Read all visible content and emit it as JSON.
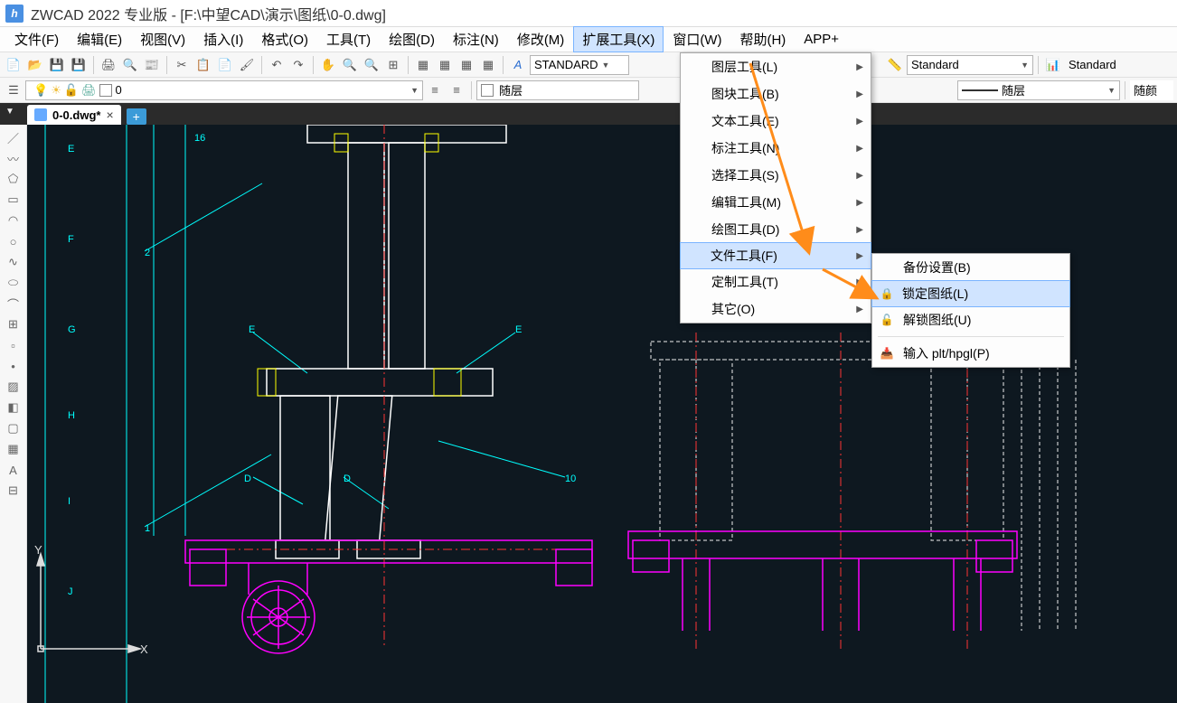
{
  "title": "ZWCAD 2022 专业版 - [F:\\中望CAD\\演示\\图纸\\0-0.dwg]",
  "menus": {
    "file": "文件(F)",
    "edit": "编辑(E)",
    "view": "视图(V)",
    "insert": "插入(I)",
    "format": "格式(O)",
    "tool": "工具(T)",
    "draw": "绘图(D)",
    "dim": "标注(N)",
    "modify": "修改(M)",
    "ext": "扩展工具(X)",
    "window": "窗口(W)",
    "help": "帮助(H)",
    "app": "APP+"
  },
  "toolbar1": {
    "textstyle": "STANDARD",
    "style1": "Standard",
    "style2": "Standard"
  },
  "toolbar2": {
    "layer": "0",
    "bylayer1": "随层",
    "bylayer2": "随层",
    "bylayer3": "随颜"
  },
  "tab": {
    "name": "0-0.dwg*"
  },
  "dropdown1": {
    "items": [
      {
        "label": "图层工具(L)"
      },
      {
        "label": "图块工具(B)"
      },
      {
        "label": "文本工具(E)"
      },
      {
        "label": "标注工具(N)"
      },
      {
        "label": "选择工具(S)"
      },
      {
        "label": "编辑工具(M)"
      },
      {
        "label": "绘图工具(D)"
      },
      {
        "label": "文件工具(F)",
        "hl": true
      },
      {
        "label": "定制工具(T)"
      },
      {
        "label": "其它(O)"
      }
    ]
  },
  "dropdown2": {
    "items": [
      {
        "label": "备份设置(B)"
      },
      {
        "label": "锁定图纸(L)",
        "hl": true,
        "icon": "🔒"
      },
      {
        "label": "解锁图纸(U)",
        "icon": "🔓"
      },
      {
        "sep": true
      },
      {
        "label": "输入 plt/hpgl(P)",
        "icon": "📄"
      }
    ]
  },
  "axes": {
    "x": "X",
    "y": "Y"
  },
  "canvas_labels": {
    "e1": "E",
    "f": "F",
    "g": "G",
    "h": "H",
    "i": "I",
    "j": "J",
    "e2": "E",
    "e3": "E",
    "d1": "D",
    "d2": "D",
    "n1": "1",
    "n2": "2",
    "n10": "10",
    "n16": "16"
  }
}
